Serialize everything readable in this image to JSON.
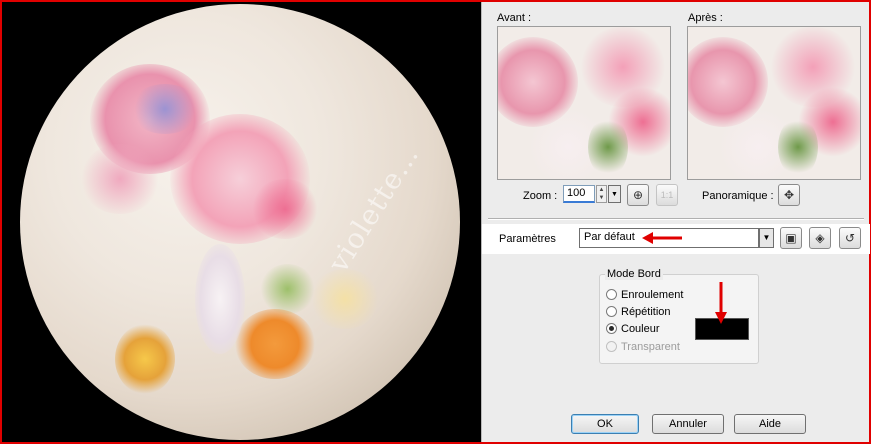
{
  "dialog": {
    "before_label": "Avant :",
    "after_label": "Après :",
    "zoom_label": "Zoom :",
    "zoom_value": "100",
    "zoom_actual_size_label": "1:1",
    "pan_label": "Panoramique :",
    "preset_label": "Paramètres",
    "preset_value": "Par défaut",
    "mode_group_title": "Mode Bord",
    "modes": [
      {
        "label": "Enroulement",
        "checked": false,
        "disabled": false
      },
      {
        "label": "Répétition",
        "checked": false,
        "disabled": false
      },
      {
        "label": "Couleur",
        "checked": true,
        "disabled": false
      },
      {
        "label": "Transparent",
        "checked": false,
        "disabled": true
      }
    ],
    "edge_color": "#000000",
    "ok_label": "OK",
    "cancel_label": "Annuler",
    "help_label": "Aide"
  },
  "annotation_color": "#e00000"
}
